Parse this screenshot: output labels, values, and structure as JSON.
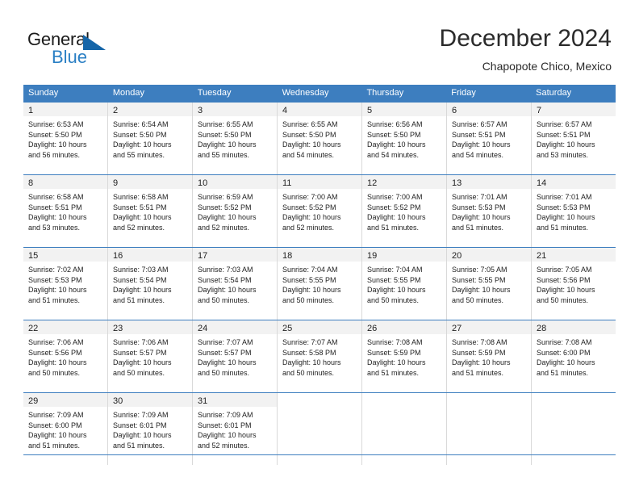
{
  "brand": {
    "name_part1": "General",
    "name_part2": "Blue",
    "triangle_icon": "triangle-icon",
    "accent_dark": "#1565a8",
    "accent_light": "#2a7fc4"
  },
  "header": {
    "title": "December 2024",
    "subtitle": "Chapopote Chico, Mexico"
  },
  "calendar": {
    "header_bg": "#3d7ebf",
    "daynum_bg": "#f2f2f2",
    "day_names": [
      "Sunday",
      "Monday",
      "Tuesday",
      "Wednesday",
      "Thursday",
      "Friday",
      "Saturday"
    ],
    "weeks": [
      [
        {
          "day": "1",
          "sunrise": "Sunrise: 6:53 AM",
          "sunset": "Sunset: 5:50 PM",
          "daylight_line1": "Daylight: 10 hours",
          "daylight_line2": "and 56 minutes."
        },
        {
          "day": "2",
          "sunrise": "Sunrise: 6:54 AM",
          "sunset": "Sunset: 5:50 PM",
          "daylight_line1": "Daylight: 10 hours",
          "daylight_line2": "and 55 minutes."
        },
        {
          "day": "3",
          "sunrise": "Sunrise: 6:55 AM",
          "sunset": "Sunset: 5:50 PM",
          "daylight_line1": "Daylight: 10 hours",
          "daylight_line2": "and 55 minutes."
        },
        {
          "day": "4",
          "sunrise": "Sunrise: 6:55 AM",
          "sunset": "Sunset: 5:50 PM",
          "daylight_line1": "Daylight: 10 hours",
          "daylight_line2": "and 54 minutes."
        },
        {
          "day": "5",
          "sunrise": "Sunrise: 6:56 AM",
          "sunset": "Sunset: 5:50 PM",
          "daylight_line1": "Daylight: 10 hours",
          "daylight_line2": "and 54 minutes."
        },
        {
          "day": "6",
          "sunrise": "Sunrise: 6:57 AM",
          "sunset": "Sunset: 5:51 PM",
          "daylight_line1": "Daylight: 10 hours",
          "daylight_line2": "and 54 minutes."
        },
        {
          "day": "7",
          "sunrise": "Sunrise: 6:57 AM",
          "sunset": "Sunset: 5:51 PM",
          "daylight_line1": "Daylight: 10 hours",
          "daylight_line2": "and 53 minutes."
        }
      ],
      [
        {
          "day": "8",
          "sunrise": "Sunrise: 6:58 AM",
          "sunset": "Sunset: 5:51 PM",
          "daylight_line1": "Daylight: 10 hours",
          "daylight_line2": "and 53 minutes."
        },
        {
          "day": "9",
          "sunrise": "Sunrise: 6:58 AM",
          "sunset": "Sunset: 5:51 PM",
          "daylight_line1": "Daylight: 10 hours",
          "daylight_line2": "and 52 minutes."
        },
        {
          "day": "10",
          "sunrise": "Sunrise: 6:59 AM",
          "sunset": "Sunset: 5:52 PM",
          "daylight_line1": "Daylight: 10 hours",
          "daylight_line2": "and 52 minutes."
        },
        {
          "day": "11",
          "sunrise": "Sunrise: 7:00 AM",
          "sunset": "Sunset: 5:52 PM",
          "daylight_line1": "Daylight: 10 hours",
          "daylight_line2": "and 52 minutes."
        },
        {
          "day": "12",
          "sunrise": "Sunrise: 7:00 AM",
          "sunset": "Sunset: 5:52 PM",
          "daylight_line1": "Daylight: 10 hours",
          "daylight_line2": "and 51 minutes."
        },
        {
          "day": "13",
          "sunrise": "Sunrise: 7:01 AM",
          "sunset": "Sunset: 5:53 PM",
          "daylight_line1": "Daylight: 10 hours",
          "daylight_line2": "and 51 minutes."
        },
        {
          "day": "14",
          "sunrise": "Sunrise: 7:01 AM",
          "sunset": "Sunset: 5:53 PM",
          "daylight_line1": "Daylight: 10 hours",
          "daylight_line2": "and 51 minutes."
        }
      ],
      [
        {
          "day": "15",
          "sunrise": "Sunrise: 7:02 AM",
          "sunset": "Sunset: 5:53 PM",
          "daylight_line1": "Daylight: 10 hours",
          "daylight_line2": "and 51 minutes."
        },
        {
          "day": "16",
          "sunrise": "Sunrise: 7:03 AM",
          "sunset": "Sunset: 5:54 PM",
          "daylight_line1": "Daylight: 10 hours",
          "daylight_line2": "and 51 minutes."
        },
        {
          "day": "17",
          "sunrise": "Sunrise: 7:03 AM",
          "sunset": "Sunset: 5:54 PM",
          "daylight_line1": "Daylight: 10 hours",
          "daylight_line2": "and 50 minutes."
        },
        {
          "day": "18",
          "sunrise": "Sunrise: 7:04 AM",
          "sunset": "Sunset: 5:55 PM",
          "daylight_line1": "Daylight: 10 hours",
          "daylight_line2": "and 50 minutes."
        },
        {
          "day": "19",
          "sunrise": "Sunrise: 7:04 AM",
          "sunset": "Sunset: 5:55 PM",
          "daylight_line1": "Daylight: 10 hours",
          "daylight_line2": "and 50 minutes."
        },
        {
          "day": "20",
          "sunrise": "Sunrise: 7:05 AM",
          "sunset": "Sunset: 5:55 PM",
          "daylight_line1": "Daylight: 10 hours",
          "daylight_line2": "and 50 minutes."
        },
        {
          "day": "21",
          "sunrise": "Sunrise: 7:05 AM",
          "sunset": "Sunset: 5:56 PM",
          "daylight_line1": "Daylight: 10 hours",
          "daylight_line2": "and 50 minutes."
        }
      ],
      [
        {
          "day": "22",
          "sunrise": "Sunrise: 7:06 AM",
          "sunset": "Sunset: 5:56 PM",
          "daylight_line1": "Daylight: 10 hours",
          "daylight_line2": "and 50 minutes."
        },
        {
          "day": "23",
          "sunrise": "Sunrise: 7:06 AM",
          "sunset": "Sunset: 5:57 PM",
          "daylight_line1": "Daylight: 10 hours",
          "daylight_line2": "and 50 minutes."
        },
        {
          "day": "24",
          "sunrise": "Sunrise: 7:07 AM",
          "sunset": "Sunset: 5:57 PM",
          "daylight_line1": "Daylight: 10 hours",
          "daylight_line2": "and 50 minutes."
        },
        {
          "day": "25",
          "sunrise": "Sunrise: 7:07 AM",
          "sunset": "Sunset: 5:58 PM",
          "daylight_line1": "Daylight: 10 hours",
          "daylight_line2": "and 50 minutes."
        },
        {
          "day": "26",
          "sunrise": "Sunrise: 7:08 AM",
          "sunset": "Sunset: 5:59 PM",
          "daylight_line1": "Daylight: 10 hours",
          "daylight_line2": "and 51 minutes."
        },
        {
          "day": "27",
          "sunrise": "Sunrise: 7:08 AM",
          "sunset": "Sunset: 5:59 PM",
          "daylight_line1": "Daylight: 10 hours",
          "daylight_line2": "and 51 minutes."
        },
        {
          "day": "28",
          "sunrise": "Sunrise: 7:08 AM",
          "sunset": "Sunset: 6:00 PM",
          "daylight_line1": "Daylight: 10 hours",
          "daylight_line2": "and 51 minutes."
        }
      ],
      [
        {
          "day": "29",
          "sunrise": "Sunrise: 7:09 AM",
          "sunset": "Sunset: 6:00 PM",
          "daylight_line1": "Daylight: 10 hours",
          "daylight_line2": "and 51 minutes."
        },
        {
          "day": "30",
          "sunrise": "Sunrise: 7:09 AM",
          "sunset": "Sunset: 6:01 PM",
          "daylight_line1": "Daylight: 10 hours",
          "daylight_line2": "and 51 minutes."
        },
        {
          "day": "31",
          "sunrise": "Sunrise: 7:09 AM",
          "sunset": "Sunset: 6:01 PM",
          "daylight_line1": "Daylight: 10 hours",
          "daylight_line2": "and 52 minutes."
        },
        {
          "day": "",
          "sunrise": "",
          "sunset": "",
          "daylight_line1": "",
          "daylight_line2": ""
        },
        {
          "day": "",
          "sunrise": "",
          "sunset": "",
          "daylight_line1": "",
          "daylight_line2": ""
        },
        {
          "day": "",
          "sunrise": "",
          "sunset": "",
          "daylight_line1": "",
          "daylight_line2": ""
        },
        {
          "day": "",
          "sunrise": "",
          "sunset": "",
          "daylight_line1": "",
          "daylight_line2": ""
        }
      ]
    ]
  }
}
